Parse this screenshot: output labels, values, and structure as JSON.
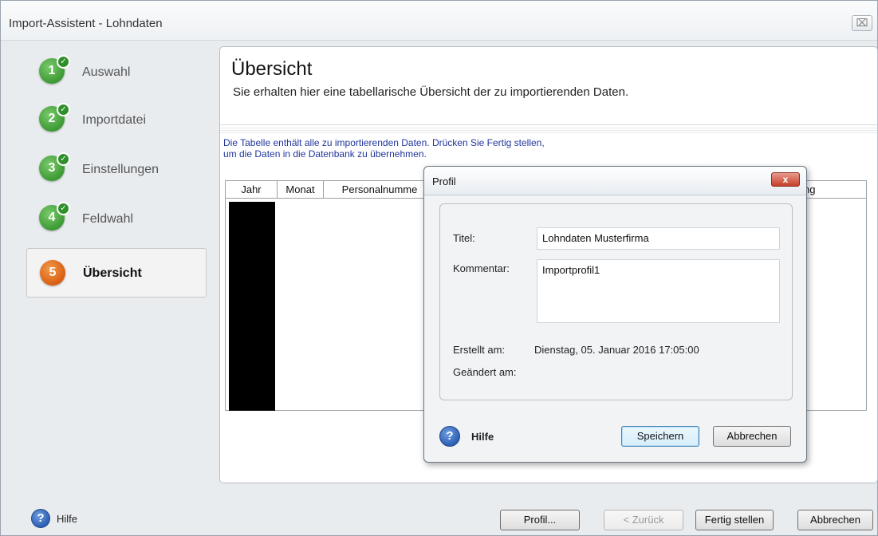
{
  "window": {
    "title": "Import-Assistent - Lohndaten",
    "close_glyph": "⌧"
  },
  "steps": [
    {
      "number": "1",
      "label": "Auswahl",
      "state": "done"
    },
    {
      "number": "2",
      "label": "Importdatei",
      "state": "done"
    },
    {
      "number": "3",
      "label": "Einstellungen",
      "state": "done"
    },
    {
      "number": "4",
      "label": "Feldwahl",
      "state": "done"
    },
    {
      "number": "5",
      "label": "Übersicht",
      "state": "current"
    }
  ],
  "main": {
    "title": "Übersicht",
    "subtitle": "Sie erhalten hier eine tabellarische Übersicht der zu importierenden Daten.",
    "info_line1": "Die Tabelle enthält alle zu importierenden Daten. Drücken Sie Fertig stellen,",
    "info_line2": "um die Daten in die Datenbank zu übernehmen.",
    "columns": [
      "Jahr",
      "Monat",
      "Personalnumme",
      "ng"
    ]
  },
  "footer": {
    "help_label": "Hilfe",
    "profile_button": "Profil...",
    "back_button": "< Zurück",
    "finish_button": "Fertig stellen",
    "cancel_button": "Abbrechen"
  },
  "dialog": {
    "title": "Profil",
    "close_glyph": "x",
    "title_label": "Titel:",
    "title_value": "Lohndaten Musterfirma",
    "comment_label": "Kommentar:",
    "comment_value": "Importprofil1",
    "created_label": "Erstellt am:",
    "created_value": "Dienstag, 05. Januar 2016 17:05:00",
    "changed_label": "Geändert am:",
    "help_label": "Hilfe",
    "save_button": "Speichern",
    "cancel_button": "Abbrechen"
  },
  "colors": {
    "step_done": "#3c9a34",
    "step_current": "#d85e12",
    "info_text": "#21369c",
    "dialog_close": "#c6402b"
  }
}
